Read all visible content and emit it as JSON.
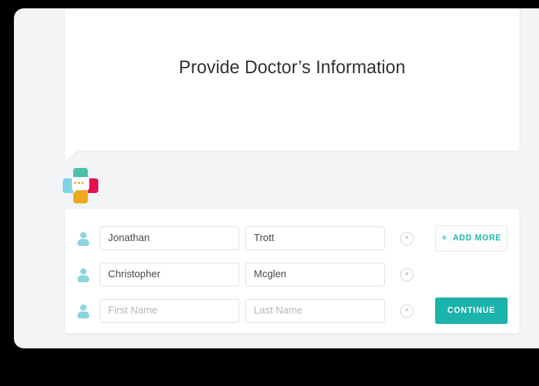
{
  "header": {
    "title": "Provide Doctor’s Information"
  },
  "logo": {
    "name": "medical-chat-logo",
    "colors": {
      "top": "#4bc0ac",
      "left": "#7fd3e3",
      "right": "#e5124f",
      "bottom": "#edaa21",
      "bubble": "#ffffff",
      "dots": "#edaa21"
    }
  },
  "theme": {
    "accent": "#1bb3ab",
    "accent_text": "#23b5ad",
    "page_background": "#f2f4f6",
    "card_background": "#ffffff",
    "input_border": "#dcdfe3",
    "placeholder_color": "#b4b8bd",
    "person_icon": "#8ad5e0",
    "title_color": "#313131"
  },
  "form": {
    "rows": [
      {
        "icon": "person-icon",
        "first_name": "Jonathan",
        "last_name": "Trott",
        "first_placeholder": "First Name",
        "last_placeholder": "Last Name",
        "remove_label": "×"
      },
      {
        "icon": "person-icon",
        "first_name": "Christopher",
        "last_name": "Mcglen",
        "first_placeholder": "First Name",
        "last_placeholder": "Last Name",
        "remove_label": "×"
      },
      {
        "icon": "person-icon",
        "first_name": "",
        "last_name": "",
        "first_placeholder": "First Name",
        "last_placeholder": "Last Name",
        "remove_label": "×"
      }
    ]
  },
  "buttons": {
    "add_more_label": "ADD MORE",
    "add_more_icon": "+",
    "continue_label": "CONTINUE"
  }
}
